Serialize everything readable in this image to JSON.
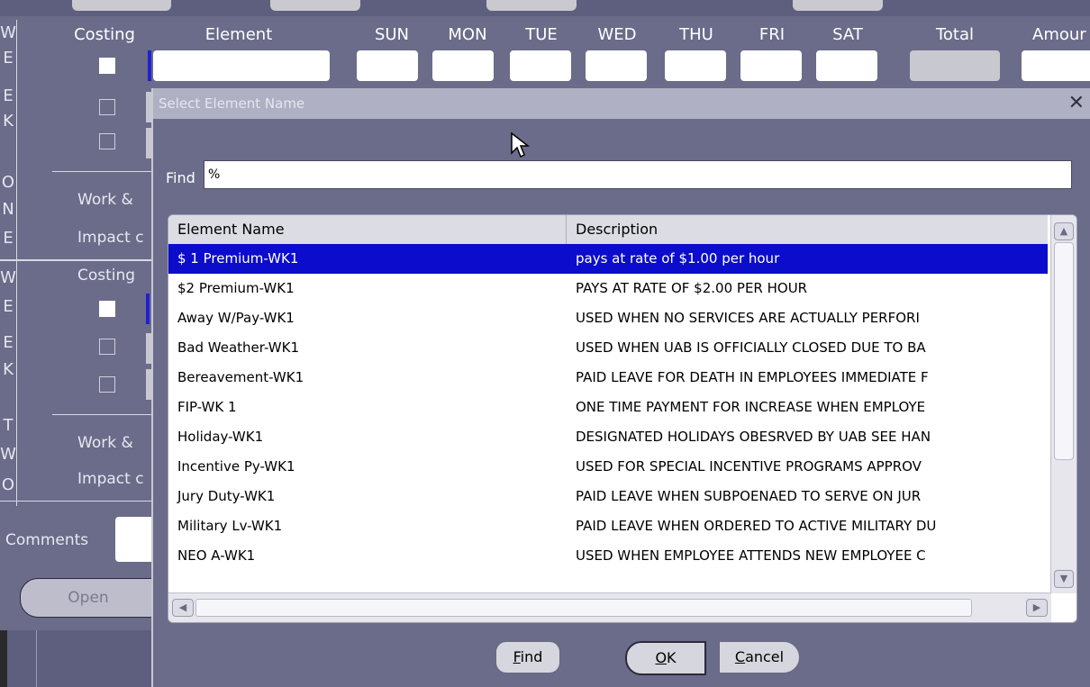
{
  "week_form": {
    "headers": [
      "Costing",
      "Element",
      "SUN",
      "MON",
      "TUE",
      "WED",
      "THU",
      "FRI",
      "SAT",
      "Total",
      "Amour"
    ],
    "sidebar_week_one": [
      "W",
      "E",
      "E",
      "K",
      "O",
      "N",
      "E"
    ],
    "sidebar_week_two": [
      "W",
      "E",
      "E",
      "K",
      "T",
      "W",
      "O"
    ],
    "row_labels": {
      "work1": "Work &",
      "impact1": "Impact c",
      "costing2": "Costing",
      "work2": "Work &",
      "impact2": "Impact c"
    },
    "comments_label": "Comments",
    "open_label": "Open"
  },
  "dialog": {
    "title": "Select Element Name",
    "close_glyph": "✕",
    "find_label": "Find",
    "find_value": "%",
    "columns": [
      "Element Name",
      "Description"
    ],
    "rows": [
      {
        "name": "$ 1 Premium-WK1",
        "description": "pays at rate of $1.00 per hour",
        "selected": true
      },
      {
        "name": "$2 Premium-WK1",
        "description": "PAYS AT RATE OF $2.00 PER HOUR"
      },
      {
        "name": "Away W/Pay-WK1",
        "description": "USED WHEN NO SERVICES ARE ACTUALLY PERFORI"
      },
      {
        "name": "Bad Weather-WK1",
        "description": "USED WHEN UAB IS OFFICIALLY CLOSED DUE TO BA"
      },
      {
        "name": "Bereavement-WK1",
        "description": "PAID LEAVE FOR DEATH IN EMPLOYEES IMMEDIATE F"
      },
      {
        "name": "FIP-WK 1",
        "description": "ONE TIME PAYMENT FOR INCREASE WHEN EMPLOYE"
      },
      {
        "name": "Holiday-WK1",
        "description": "DESIGNATED HOLIDAYS OBESRVED BY UAB SEE HAN"
      },
      {
        "name": "Incentive Py-WK1",
        "description": "USED FOR SPECIAL INCENTIVE PROGRAMS APPROV"
      },
      {
        "name": "Jury Duty-WK1",
        "description": "PAID LEAVE WHEN SUBPOENAED TO SERVE ON JUR"
      },
      {
        "name": "Military Lv-WK1",
        "description": "PAID LEAVE WHEN ORDERED TO ACTIVE MILITARY DU"
      },
      {
        "name": "NEO A-WK1",
        "description": "USED WHEN EMPLOYEE ATTENDS NEW EMPLOYEE C"
      }
    ],
    "buttons": {
      "find": {
        "mnemonic": "F",
        "rest": "ind"
      },
      "ok": {
        "mnemonic": "O",
        "rest": "K"
      },
      "cancel": {
        "mnemonic": "C",
        "rest": "ancel"
      }
    }
  },
  "colors": {
    "form_bg": "#6b6b8a",
    "selection": "#0c0ccc",
    "titlebar": "#b0b0c4"
  },
  "icons": [
    "close-icon",
    "scroll-up-icon",
    "scroll-down-icon",
    "scroll-left-icon",
    "scroll-right-icon",
    "mouse-pointer-icon"
  ]
}
